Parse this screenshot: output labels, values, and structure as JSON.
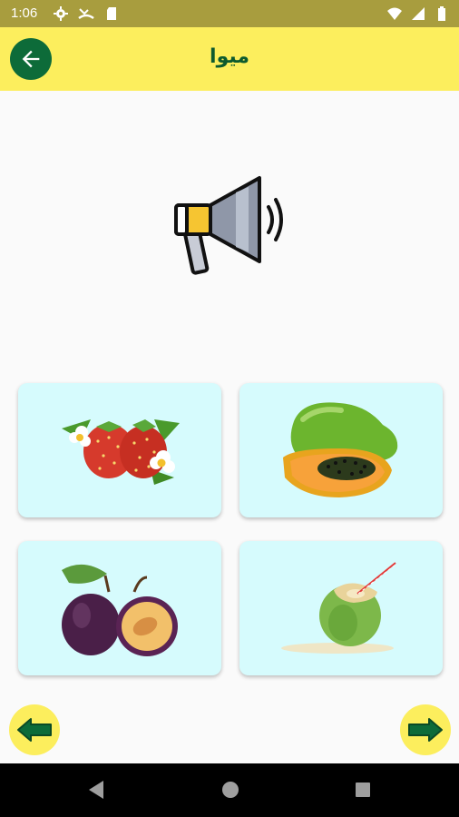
{
  "status_bar": {
    "time": "1:06",
    "left_icons": [
      "gear-icon",
      "call-missed-icon",
      "sd-card-icon"
    ],
    "right_icons": [
      "wifi-icon",
      "signal-icon",
      "battery-icon"
    ]
  },
  "app_bar": {
    "title": "میوا",
    "back_icon": "arrow-back-icon"
  },
  "speaker": {
    "icon": "megaphone-icon"
  },
  "cards": [
    {
      "image": "strawberry-image"
    },
    {
      "image": "papaya-image"
    },
    {
      "image": "plum-image"
    },
    {
      "image": "coconut-image"
    }
  ],
  "navigation": {
    "previous_icon": "arrow-left-icon",
    "next_icon": "arrow-right-icon"
  },
  "system_nav": [
    "back-triangle-icon",
    "home-circle-icon",
    "recents-square-icon"
  ],
  "colors": {
    "status_bar": "#a89d3e",
    "app_bar": "#fcee5d",
    "accent_green": "#0d6b39",
    "card_bg": "#d6fbfd"
  }
}
